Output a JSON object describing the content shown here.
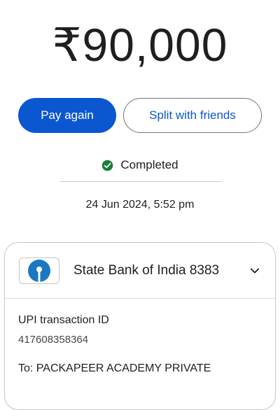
{
  "payment": {
    "amount": "₹90,000",
    "status": "Completed",
    "datetime": "24 Jun 2024, 5:52 pm"
  },
  "actions": {
    "pay_again": "Pay again",
    "split": "Split with friends"
  },
  "account": {
    "bank_name": "State Bank of India 8383"
  },
  "details": {
    "txn_label": "UPI transaction ID",
    "txn_id": "417608358364",
    "to_line": "To: PACKAPEER ACADEMY PRIVATE"
  },
  "colors": {
    "primary": "#0b57d0",
    "success": "#188038",
    "sbi_blue": "#1a78c2"
  },
  "icons": [
    "check-circle-icon",
    "sbi-logo-icon",
    "chevron-down-icon"
  ]
}
